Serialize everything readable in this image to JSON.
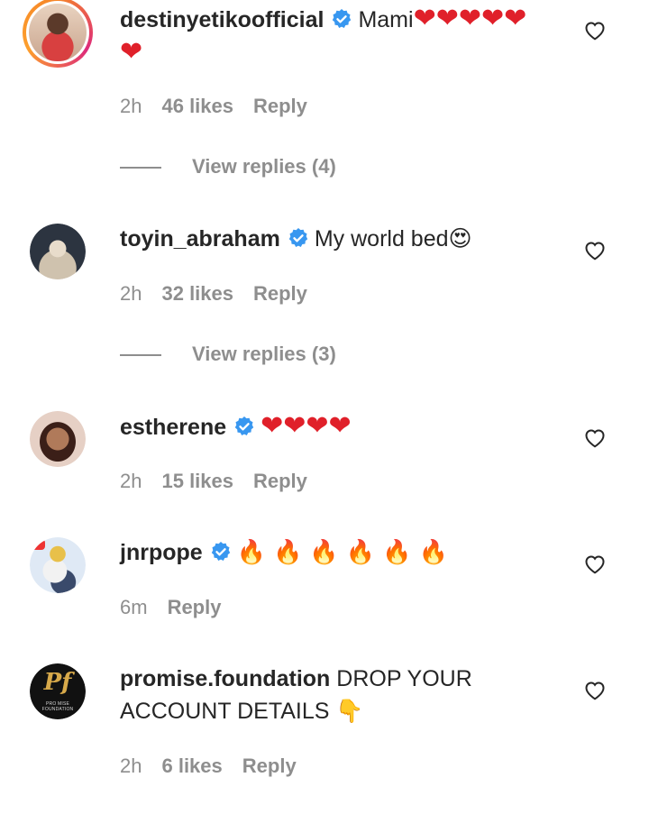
{
  "comments": [
    {
      "username": "destinyetikoofficial",
      "text": "Mami",
      "emoji": "❤❤❤❤❤❤",
      "time": "2h",
      "likes": "46 likes",
      "reply": "Reply",
      "view_replies": "View replies (4)"
    },
    {
      "username": "toyin_abraham",
      "text": "My world bed",
      "emoji": "😍",
      "time": "2h",
      "likes": "32 likes",
      "reply": "Reply",
      "view_replies": "View replies (3)"
    },
    {
      "username": "estherene",
      "text": "",
      "emoji": "❤❤❤❤",
      "time": "2h",
      "likes": "15 likes",
      "reply": "Reply"
    },
    {
      "username": "jnrpope",
      "text": "",
      "emoji": "🔥🔥🔥🔥🔥🔥",
      "time": "6m",
      "reply": "Reply"
    },
    {
      "username": "promise.foundation",
      "text": "DROP YOUR ACCOUNT DETAILS",
      "emoji": "👇",
      "avatar_logo": "Pf",
      "avatar_sub": "PRO MISE FOUNDATION",
      "time": "2h",
      "likes": "6 likes",
      "reply": "Reply"
    }
  ],
  "colors": {
    "text": "#262626",
    "muted": "#8e8e8e",
    "verified": "#3897f0",
    "heart_red": "#e0202a"
  },
  "icons": {
    "verified": "verified-badge-icon",
    "like": "heart-outline-icon"
  }
}
